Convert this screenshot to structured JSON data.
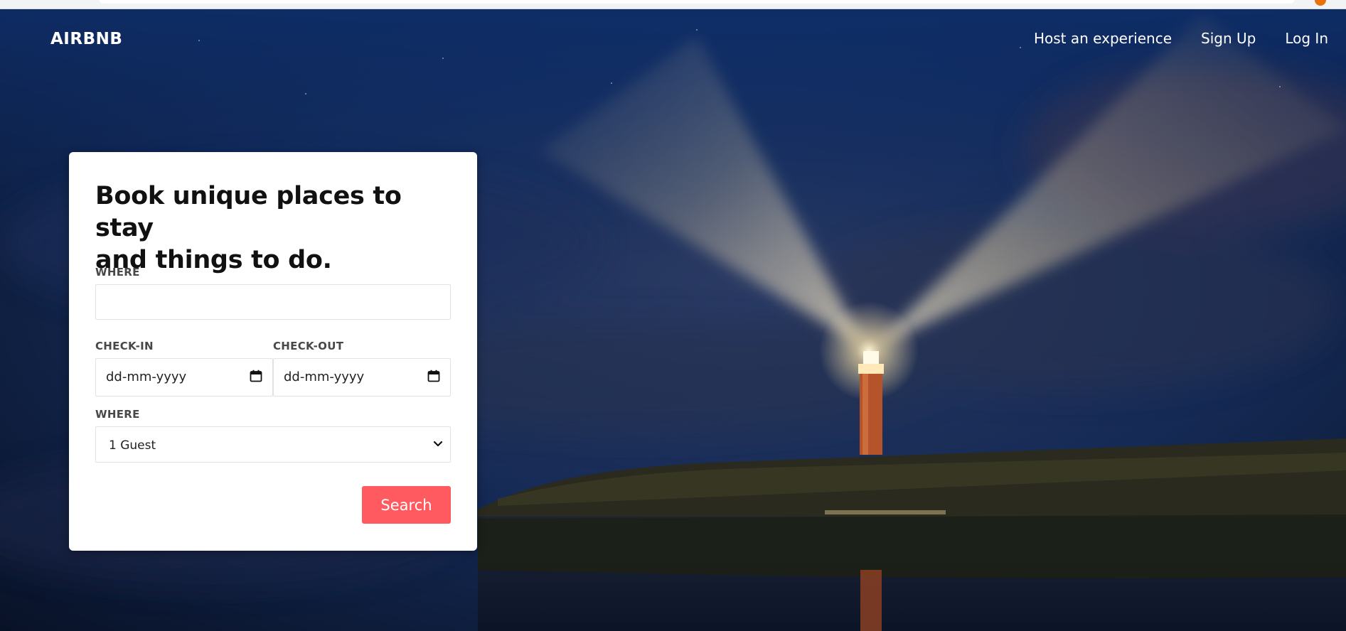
{
  "brand": "AIRBNB",
  "nav": {
    "host": "Host an experience",
    "signup": "Sign Up",
    "login": "Log In"
  },
  "card": {
    "heading_line1": "Book unique places to stay",
    "heading_line2": "and things to do.",
    "where_label": "WHERE",
    "where_value": "",
    "checkin_label": "CHECK-IN",
    "checkin_placeholder": "dd-mm-yyyy",
    "checkout_label": "CHECK-OUT",
    "checkout_placeholder": "dd-mm-yyyy",
    "guests_label": "WHERE",
    "guests_selected": "1 Guest",
    "search_label": "Search"
  },
  "icons": {
    "date": "calendar-icon",
    "select": "chevron-down-icon"
  },
  "colors": {
    "accent": "#ff5a5f",
    "card": "#ffffff",
    "sky": "#0f2a5a"
  }
}
